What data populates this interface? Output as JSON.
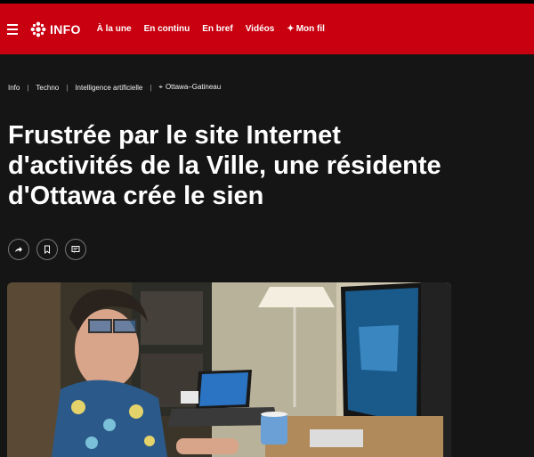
{
  "header": {
    "logo_text": "INFO",
    "nav": [
      {
        "label": "À la une"
      },
      {
        "label": "En continu"
      },
      {
        "label": "En bref"
      },
      {
        "label": "Vidéos"
      },
      {
        "label": "Mon fil"
      }
    ],
    "colors": {
      "brand": "#c8000f"
    }
  },
  "breadcrumb": {
    "items": [
      "Info",
      "Techno",
      "Intelligence artificielle"
    ],
    "location": "Ottawa–Gatineau"
  },
  "article": {
    "title": "Frustrée par le site Internet d'activités de la Ville, une résidente d'Ottawa crée le sien"
  },
  "actions": [
    {
      "icon": "share-icon"
    },
    {
      "icon": "bookmark-icon"
    },
    {
      "icon": "comment-icon"
    }
  ]
}
